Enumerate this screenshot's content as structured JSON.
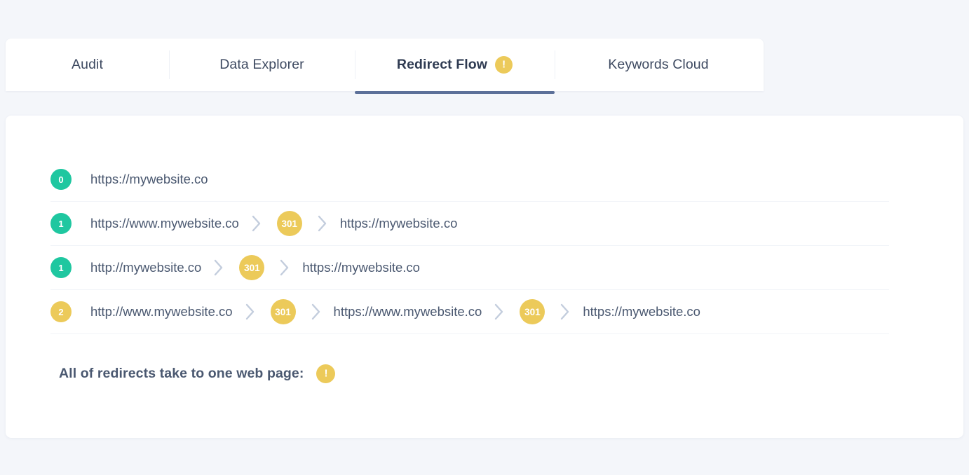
{
  "tabs": [
    {
      "label": "Audit",
      "active": false,
      "badge": null
    },
    {
      "label": "Data Explorer",
      "active": false,
      "badge": null
    },
    {
      "label": "Redirect Flow",
      "active": true,
      "badge": "!"
    },
    {
      "label": "Keywords Cloud",
      "active": false,
      "badge": null
    }
  ],
  "redirect_flow": {
    "rows": [
      {
        "hops": "0",
        "hops_level": "teal",
        "source_url": "https://mywebsite.co",
        "steps": []
      },
      {
        "hops": "1",
        "hops_level": "teal",
        "source_url": "https://www.mywebsite.co",
        "steps": [
          {
            "status_code": "301",
            "target_url": "https://mywebsite.co"
          }
        ]
      },
      {
        "hops": "1",
        "hops_level": "teal",
        "source_url": "http://mywebsite.co",
        "steps": [
          {
            "status_code": "301",
            "target_url": "https://mywebsite.co"
          }
        ]
      },
      {
        "hops": "2",
        "hops_level": "yellow",
        "source_url": "http://www.mywebsite.co",
        "steps": [
          {
            "status_code": "301",
            "target_url": "https://www.mywebsite.co"
          },
          {
            "status_code": "301",
            "target_url": "https://mywebsite.co"
          }
        ]
      }
    ],
    "summary_text": "All of redirects take to one web page:",
    "summary_badge": "!"
  },
  "colors": {
    "page_background": "#f4f6fa",
    "card_background": "#ffffff",
    "accent_teal": "#1fc7a0",
    "accent_yellow": "#ecca5a",
    "active_tab_underline": "#5c7099",
    "text_primary": "#3e4a61",
    "text_url": "#4a5870",
    "chevron": "#c3cddd"
  },
  "icons": {
    "chevron_right": "chevron-right-icon",
    "warning": "warning-exclamation-icon"
  }
}
